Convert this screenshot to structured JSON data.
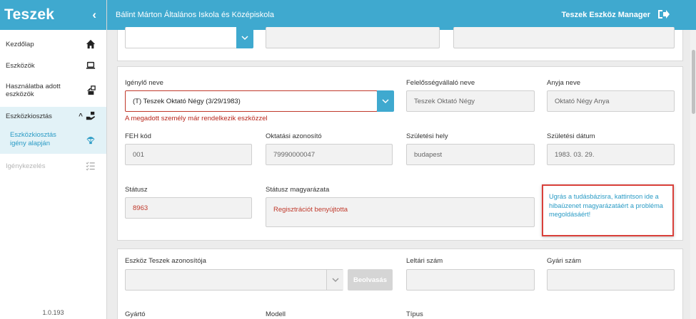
{
  "sidebar": {
    "title": "Teszek",
    "collapse_glyph": "‹",
    "items": [
      {
        "label": "Kezdőlap",
        "icon": "home-icon"
      },
      {
        "label": "Eszközök",
        "icon": "laptop-icon"
      },
      {
        "label": "Használatba adott eszközök",
        "icon": "device-given-icon"
      },
      {
        "label": "Eszközkiosztás",
        "icon": "hand-device-icon",
        "expanded_glyph": "^"
      },
      {
        "label": "Eszközkiosztás igény alapján",
        "icon": "parachute-icon"
      },
      {
        "label": "Igénykezelés",
        "icon": "list-check-icon"
      }
    ],
    "version": "1.0.193"
  },
  "topbar": {
    "school": "Bálint Márton Általános Iskola és Középiskola",
    "app_name": "Teszek Eszköz Manager",
    "logout_icon": "logout-icon"
  },
  "form": {
    "requester_label": "Igénylő neve",
    "requester_value": "(T) Teszek Oktató Négy (3/29/1983)",
    "requester_error": "A megadott személy már rendelkezik eszközzel",
    "responsible_label": "Felelősségvállaló neve",
    "responsible_value": "Teszek Oktató Négy",
    "mother_label": "Anyja neve",
    "mother_value": "Oktató Négy Anya",
    "feh_label": "FEH kód",
    "feh_value": "001",
    "edu_id_label": "Oktatási azonosító",
    "edu_id_value": "79990000047",
    "birthplace_label": "Születési hely",
    "birthplace_value": "budapest",
    "birthdate_label": "Születési dátum",
    "birthdate_value": "1983. 03. 29.",
    "status_label": "Státusz",
    "status_value": "8963",
    "status_desc_label": "Státusz magyarázata",
    "status_desc_value": "Regisztrációt benyújtotta",
    "kb_link": "Ugrás a tudásbázisra, kattintson ide a hibaüzenet magyarázatáért a probléma megoldásáért!"
  },
  "device": {
    "teszek_id_label": "Eszköz Teszek azonosítója",
    "scan_button": "Beolvasás",
    "inventory_label": "Leltári szám",
    "serial_label": "Gyári szám",
    "manufacturer_label": "Gyártó",
    "model_label": "Modell",
    "type_label": "Típus"
  },
  "colors": {
    "brand": "#3fa9cf",
    "error": "#b8261b",
    "link": "#2a9bc5"
  }
}
